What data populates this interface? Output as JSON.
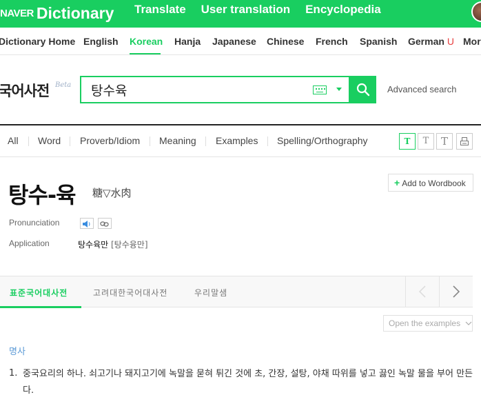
{
  "header": {
    "brand_naver": "NAVER",
    "brand_dictionary": "Dictionary",
    "nav": [
      "Translate",
      "User translation",
      "Encyclopedia"
    ]
  },
  "languages": {
    "items": [
      "Dictionary Home",
      "English",
      "Korean",
      "Hanja",
      "Japanese",
      "Chinese",
      "French",
      "Spanish",
      "German",
      "More"
    ],
    "active": "Korean",
    "german_badge": "U"
  },
  "search": {
    "dict_title": "국어사전",
    "beta": "Beta",
    "query": "탕수육",
    "advanced_label": "Advanced search"
  },
  "filters": {
    "tabs": [
      "All",
      "Word",
      "Proverb/Idiom",
      "Meaning",
      "Examples",
      "Spelling/Orthography"
    ],
    "size_buttons": [
      "T",
      "T",
      "T"
    ]
  },
  "entry": {
    "headword": "탕수-육",
    "hanja": "糖▽水肉",
    "add_wordbook": "Add to Wordbook",
    "pronunciation_label": "Pronunciation",
    "application_label": "Application",
    "application_value": "탕수육만",
    "application_pron": "[탕수융만]"
  },
  "sources": {
    "tabs": [
      "표준국어대사전",
      "고려대한국어대사전",
      "우리말샘"
    ],
    "active": "표준국어대사전"
  },
  "definition": {
    "open_examples": "Open the examples",
    "part_of_speech": "명사",
    "number": "1.",
    "text": "중국요리의 하나. 쇠고기나 돼지고기에 녹말을 묻혀 튀긴 것에 초, 간장, 설탕, 야채 따위를 넣고 끓인 녹말 물을 부어 만든다."
  },
  "colors": {
    "accent": "#19ce60",
    "pos_blue": "#5c9ad6"
  },
  "icons": [
    "search-icon",
    "keyboard-icon",
    "caret-down-icon",
    "speaker-icon",
    "link-icon",
    "print-icon",
    "chevron-left-icon",
    "chevron-right-icon",
    "chevron-down-icon"
  ]
}
